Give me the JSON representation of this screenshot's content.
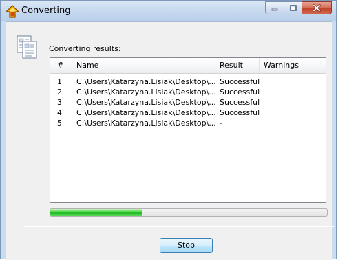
{
  "window": {
    "title": "Converting",
    "icon": "up-arrow-icon",
    "controls": {
      "minimize": "minimize-icon",
      "maximize": "maximize-icon",
      "close": "close-icon"
    }
  },
  "main": {
    "results_label": "Converting results:",
    "columns": [
      "#",
      "Name",
      "Result",
      "Warnings"
    ],
    "rows": [
      {
        "num": "1",
        "name": "C:\\Users\\Katarzyna.Lisiak\\Desktop\\...",
        "result": "Successful",
        "warnings": ""
      },
      {
        "num": "2",
        "name": "C:\\Users\\Katarzyna.Lisiak\\Desktop\\...",
        "result": "Successful",
        "warnings": ""
      },
      {
        "num": "3",
        "name": "C:\\Users\\Katarzyna.Lisiak\\Desktop\\...",
        "result": "Successful",
        "warnings": ""
      },
      {
        "num": "4",
        "name": "C:\\Users\\Katarzyna.Lisiak\\Desktop\\...",
        "result": "Successful",
        "warnings": ""
      },
      {
        "num": "5",
        "name": "C:\\Users\\Katarzyna.Lisiak\\Desktop\\...",
        "result": "-",
        "warnings": ""
      }
    ],
    "progress_percent": 33
  },
  "footer": {
    "stop_label": "Stop"
  },
  "colors": {
    "titlebar": "#c9dcf1",
    "progress_green": "#1fb81f",
    "close_red": "#c2432a"
  }
}
